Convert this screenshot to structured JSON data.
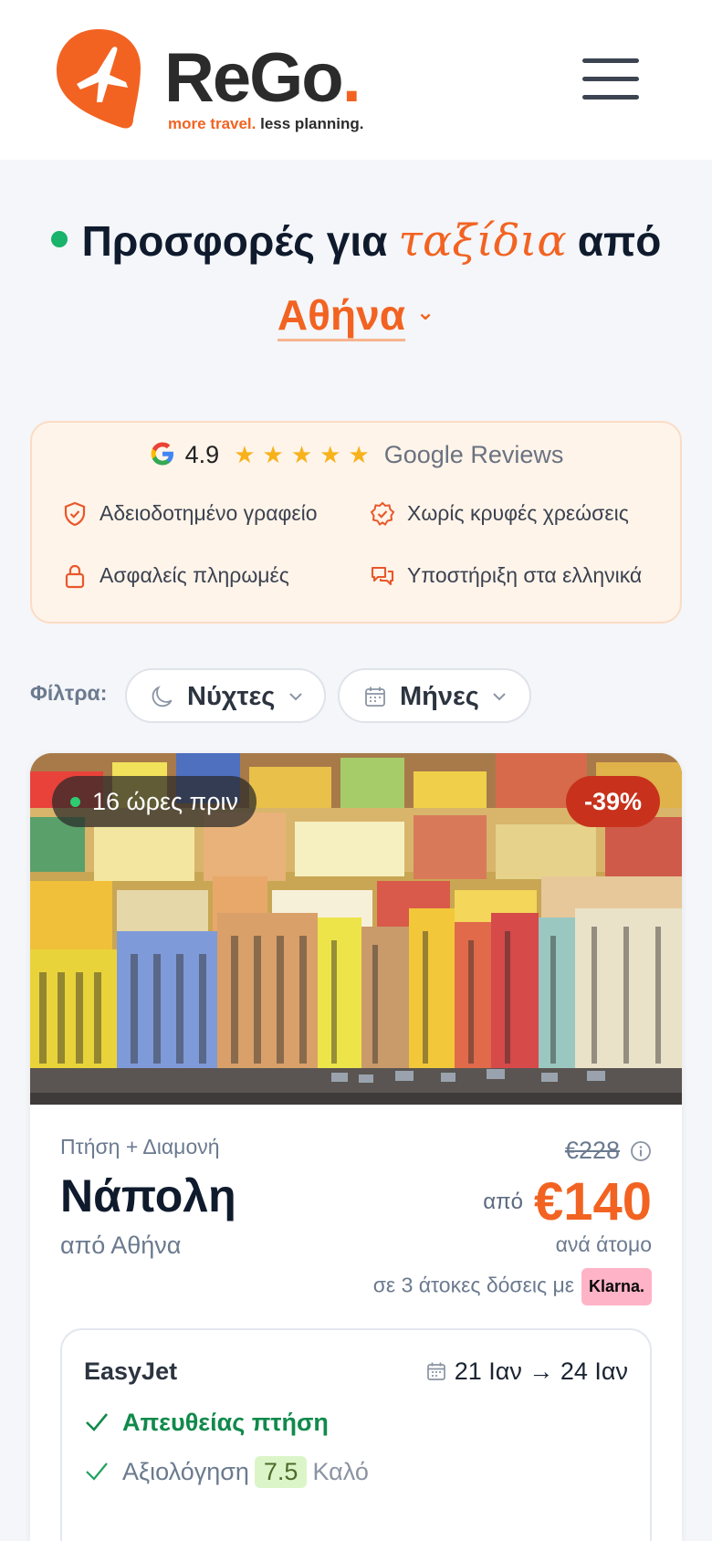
{
  "header": {
    "brand_name": "ReGo",
    "brand_dot": ".",
    "tagline_orange": "more travel.",
    "tagline_dark": "less planning.",
    "brand_color": "#f26322",
    "menu_icon": "hamburger-menu-icon"
  },
  "hero": {
    "title_part1": "Προσφορές για",
    "title_script": "ταξίδια",
    "title_part2": "από",
    "city": "Αθήνα",
    "city_chevron": "⌄"
  },
  "trust_box": {
    "rating": "4.9",
    "stars": "★★★★★",
    "reviews_label": "Google Reviews",
    "features": [
      {
        "icon": "shield-check-icon",
        "label": "Αδειοδοτημένο γραφείο"
      },
      {
        "icon": "badge-check-icon",
        "label": "Χωρίς κρυφές χρεώσεις"
      },
      {
        "icon": "lock-icon",
        "label": "Ασφαλείς πληρωμές"
      },
      {
        "icon": "chat-bubbles-icon",
        "label": "Υποστήριξη στα ελληνικά"
      }
    ]
  },
  "filters": {
    "label": "Φίλτρα:",
    "chips": [
      {
        "icon": "moon-icon",
        "label": "Νύχτες"
      },
      {
        "icon": "calendar-icon",
        "label": "Μήνες"
      }
    ]
  },
  "deal": {
    "posted": "16 ώρες πριν",
    "discount": "-39%",
    "kind": "Πτήση + Διαμονή",
    "destination": "Νάπολη",
    "origin": "από Αθήνα",
    "old_price": "€228",
    "price_prefix": "από",
    "price": "€140",
    "per_person": "ανά άτομο",
    "installments": "σε 3 άτοκες δόσεις με",
    "klarna": "Klarna.",
    "flight": {
      "airline": "EasyJet",
      "dates": "21 Ιαν → 24 Ιαν",
      "direct": "Απευθείας πτήση",
      "rating_label": "Αξιολόγηση",
      "rating_score": "7.5",
      "rating_word": "Καλό"
    }
  }
}
